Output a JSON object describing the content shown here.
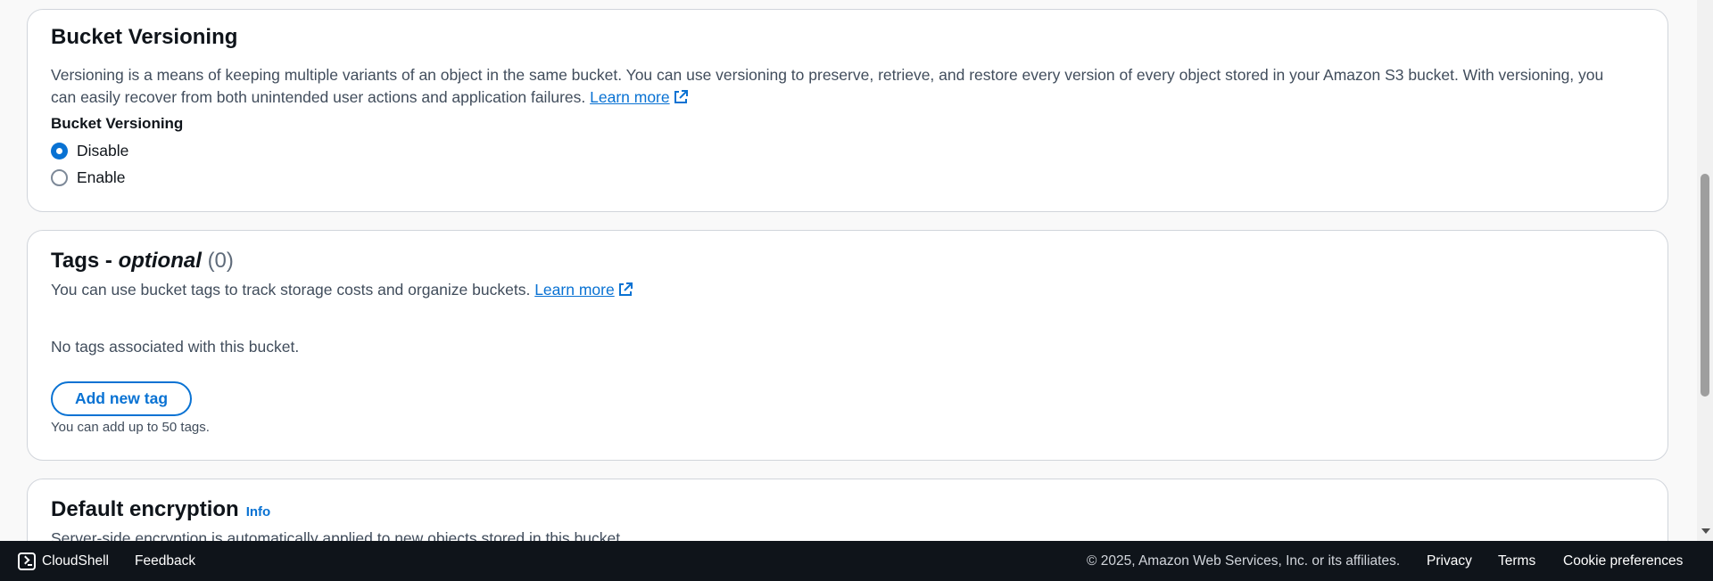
{
  "versioning": {
    "title": "Bucket Versioning",
    "description_line1": "Versioning is a means of keeping multiple variants of an object in the same bucket. You can use versioning to preserve, retrieve, and restore every version of every object stored in your Amazon S3 bucket. With versioning, you",
    "description_line2": "can easily recover from both unintended user actions and application failures.",
    "learn_more": "Learn more",
    "field_label": "Bucket Versioning",
    "options": [
      {
        "label": "Disable",
        "selected": true
      },
      {
        "label": "Enable",
        "selected": false
      }
    ]
  },
  "tags": {
    "title_prefix": "Tags - ",
    "title_italic": "optional",
    "title_count": "(0)",
    "description": "You can use bucket tags to track storage costs and organize buckets.",
    "learn_more": "Learn more",
    "empty_message": "No tags associated with this bucket.",
    "add_button": "Add new tag",
    "hint": "You can add up to 50 tags."
  },
  "encryption": {
    "title": "Default encryption",
    "info": "Info",
    "description": "Server-side encryption is automatically applied to new objects stored in this bucket."
  },
  "footer": {
    "cloudshell": "CloudShell",
    "feedback": "Feedback",
    "copyright": "© 2025, Amazon Web Services, Inc. or its affiliates.",
    "privacy": "Privacy",
    "terms": "Terms",
    "cookie_preferences": "Cookie preferences"
  },
  "colors": {
    "link": "#0972d3",
    "footer_bg": "#0f141a",
    "panel_border": "#d1d5db"
  }
}
